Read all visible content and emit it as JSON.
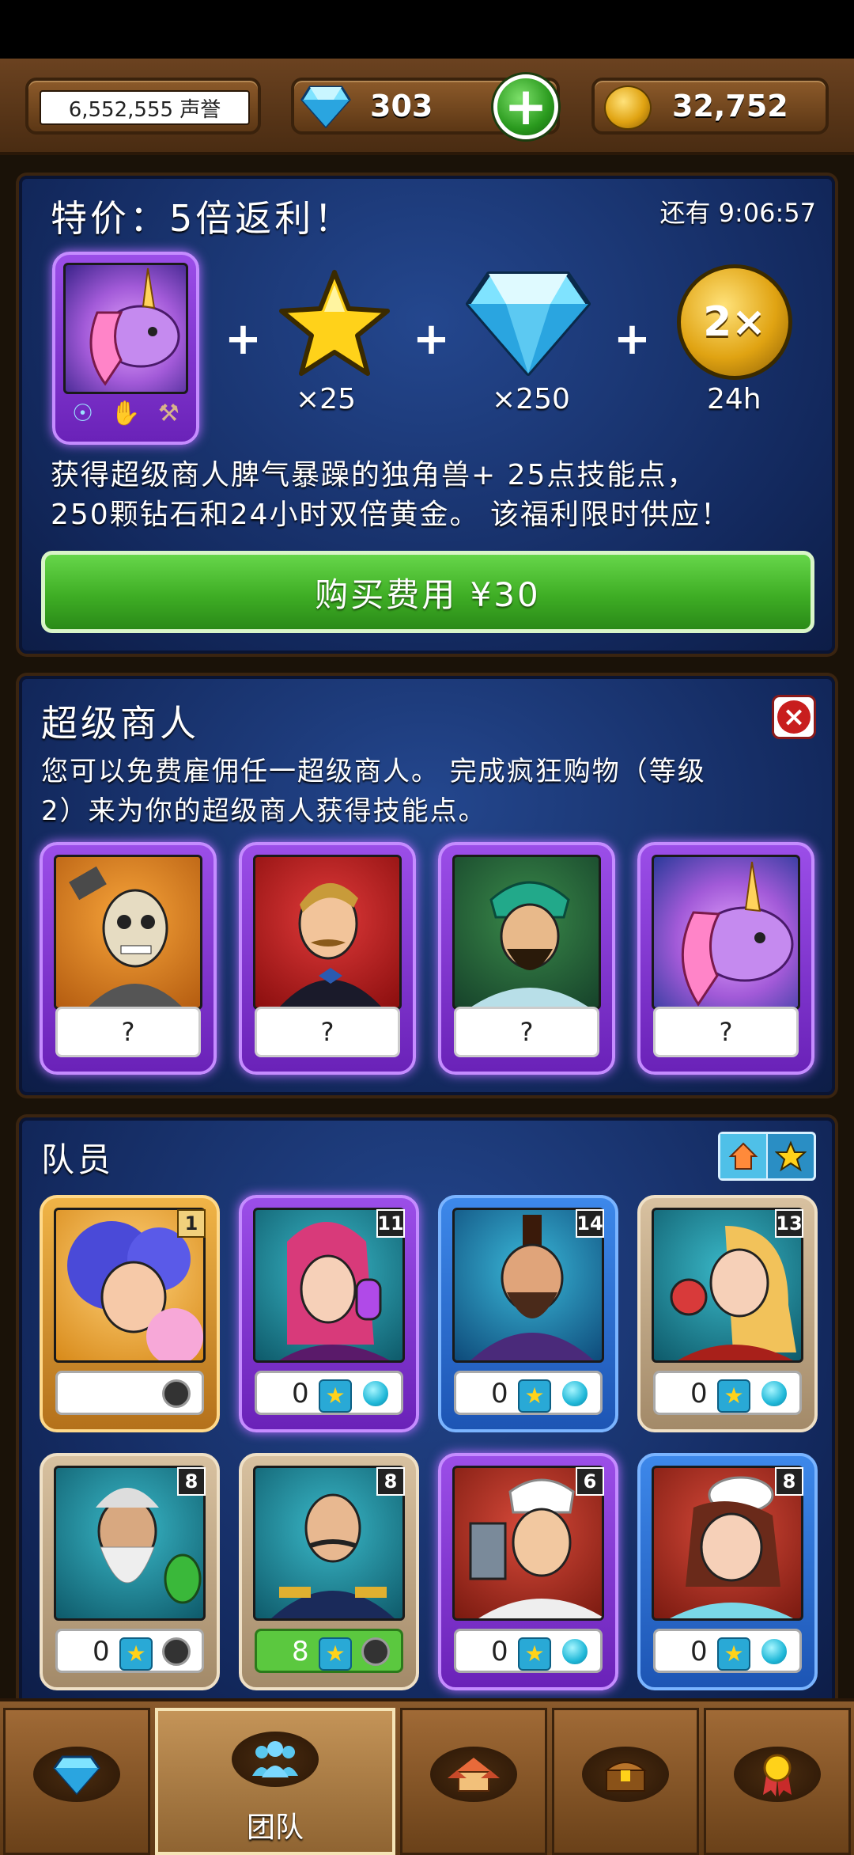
{
  "topbar": {
    "reputation": "6,552,555 声誉",
    "gems": "303",
    "gold": "32,752"
  },
  "offer": {
    "title": "特价：5倍返利！",
    "timer": "还有 9:06:57",
    "rewards": [
      {
        "icon": "star-icon",
        "label": "×25"
      },
      {
        "icon": "diamond-icon",
        "label": "×250"
      },
      {
        "icon": "double-gold-icon",
        "badge": "2×",
        "label": "24h"
      }
    ],
    "description_line1": "获得超级商人脾气暴躁的独角兽+ 25点技能点，",
    "description_line2": "250颗钻石和24小时双倍黄金。 该福利限时供应！",
    "buy_label": "购买费用 ¥30",
    "colors": {
      "panel": "#13295e",
      "buy_button": "#3fae25",
      "card_frame": "#9b4ee8"
    }
  },
  "super_merchant": {
    "title": "超级商人",
    "description_line1": "您可以免费雇佣任一超级商人。 完成疯狂购物（等级",
    "description_line2": "2）来为你的超级商人获得技能点。",
    "cards": [
      {
        "name": "skeleton-smith-portrait",
        "label": "?"
      },
      {
        "name": "gentleman-portrait",
        "label": "?"
      },
      {
        "name": "turban-warrior-portrait",
        "label": "?"
      },
      {
        "name": "unicorn-portrait",
        "label": "?"
      }
    ]
  },
  "team": {
    "title": "队员",
    "members": [
      {
        "portrait": "star-girl-portrait",
        "level": "1",
        "frame": "gold",
        "stat": "",
        "dot": "dark"
      },
      {
        "portrait": "elf-potion-portrait",
        "level": "11",
        "frame": "purple",
        "stat": "0",
        "dot": "cyan"
      },
      {
        "portrait": "mohawk-warrior-portrait",
        "level": "14",
        "frame": "blue",
        "stat": "0",
        "dot": "cyan"
      },
      {
        "portrait": "potion-lady-portrait",
        "level": "13",
        "frame": "tan",
        "stat": "0",
        "dot": "cyan"
      },
      {
        "portrait": "old-wizard-portrait",
        "level": "8",
        "frame": "tan",
        "stat": "0",
        "dot": "dark"
      },
      {
        "portrait": "general-portrait",
        "level": "8",
        "frame": "tan",
        "stat": "8",
        "dot": "dark",
        "green": true
      },
      {
        "portrait": "butcher-portrait",
        "level": "6",
        "frame": "purple",
        "stat": "0",
        "dot": "cyan"
      },
      {
        "portrait": "chef-portrait",
        "level": "8",
        "frame": "blue",
        "stat": "0",
        "dot": "cyan"
      }
    ]
  },
  "nav": {
    "tabs": [
      {
        "icon": "diamond-shop-icon",
        "label": ""
      },
      {
        "icon": "team-icon",
        "label": "团队"
      },
      {
        "icon": "buildings-icon",
        "label": ""
      },
      {
        "icon": "chest-icon",
        "label": ""
      },
      {
        "icon": "medal-icon",
        "label": ""
      }
    ]
  }
}
